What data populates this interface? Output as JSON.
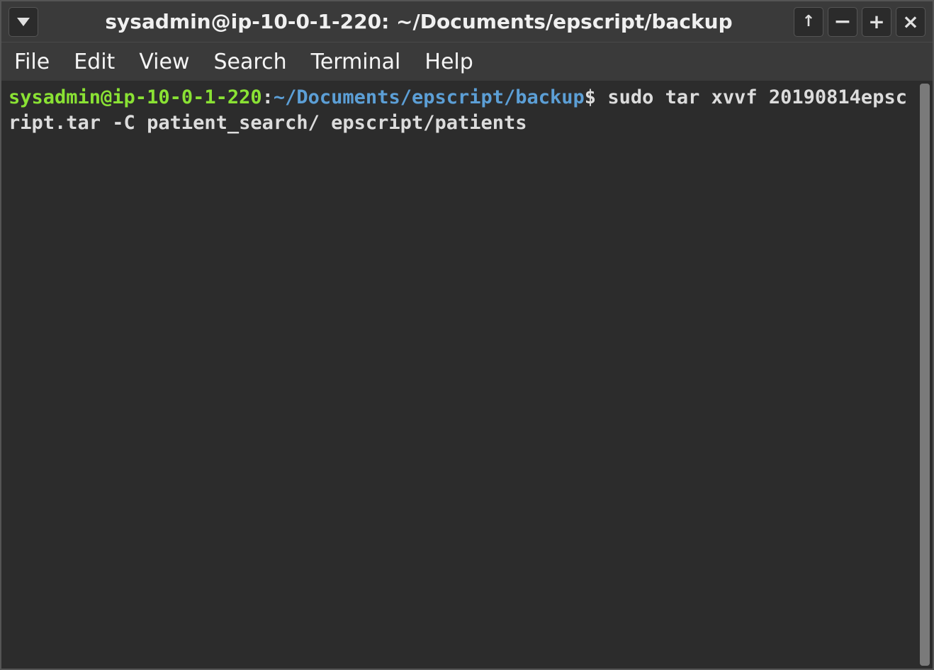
{
  "titlebar": {
    "title": "sysadmin@ip-10-0-1-220: ~/Documents/epscript/backup",
    "buttons": {
      "dropdown_icon": "caret-down",
      "upload_icon": "↑",
      "minimize_icon": "−",
      "maximize_icon": "+",
      "close_icon": "×"
    }
  },
  "menubar": {
    "items": [
      "File",
      "Edit",
      "View",
      "Search",
      "Terminal",
      "Help"
    ]
  },
  "terminal": {
    "prompt_user": "sysadmin@ip-10-0-1-220",
    "prompt_sep1": ":",
    "prompt_path": "~/Documents/epscript/backup",
    "prompt_sep2": "$",
    "command": " sudo tar xvvf 20190814epscript.tar -C patient_search/ epscript/patients"
  }
}
